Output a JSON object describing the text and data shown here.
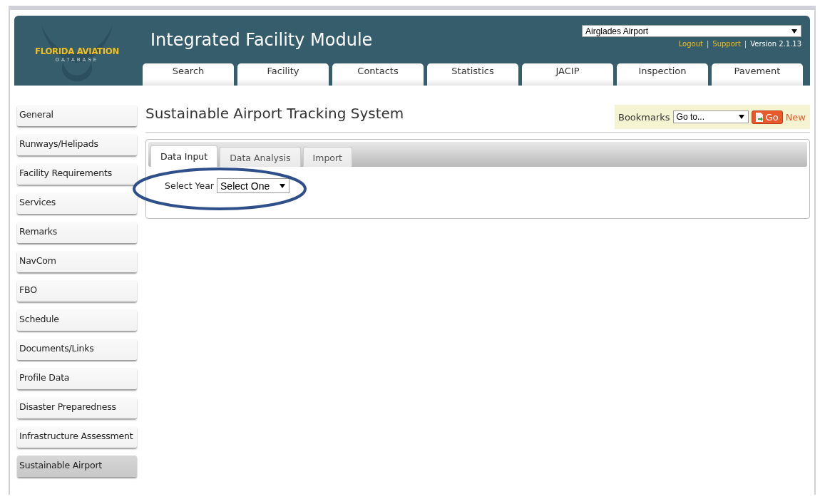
{
  "header": {
    "logo_title": "FLORIDA AVIATION",
    "logo_subtitle": "DATABASE",
    "title": "Integrated Facility Module",
    "airport_select": {
      "value": "Airglades Airport"
    },
    "links": [
      {
        "kind": "link",
        "text": "Logout"
      },
      {
        "kind": "separator",
        "text": "|"
      },
      {
        "kind": "link",
        "text": "Support"
      },
      {
        "kind": "separator",
        "text": "|"
      },
      {
        "kind": "text",
        "text": "Version 2.1.13"
      }
    ]
  },
  "nav_tabs": [
    {
      "label": "Search"
    },
    {
      "label": "Facility"
    },
    {
      "label": "Contacts"
    },
    {
      "label": "Statistics"
    },
    {
      "label": "JACIP"
    },
    {
      "label": "Inspection"
    },
    {
      "label": "Pavement"
    }
  ],
  "sidebar": {
    "items": [
      {
        "label": "General",
        "selected": false
      },
      {
        "label": "Runways/Helipads",
        "selected": false
      },
      {
        "label": "Facility Requirements",
        "selected": false
      },
      {
        "label": "Services",
        "selected": false
      },
      {
        "label": "Remarks",
        "selected": false
      },
      {
        "label": "NavCom",
        "selected": false
      },
      {
        "label": "FBO",
        "selected": false
      },
      {
        "label": "Schedule",
        "selected": false
      },
      {
        "label": "Documents/Links",
        "selected": false
      },
      {
        "label": "Profile Data",
        "selected": false
      },
      {
        "label": "Disaster Preparedness",
        "selected": false
      },
      {
        "label": "Infrastructure Assessment",
        "selected": false
      },
      {
        "label": "Sustainable Airport",
        "selected": true
      }
    ]
  },
  "page_title": "Sustainable Airport Tracking System",
  "bookmarks": {
    "label": "Bookmarks",
    "select": {
      "value": "Go to..."
    },
    "go_button": "Go",
    "new_link": "New"
  },
  "content_tabs": [
    {
      "label": "Data Input",
      "selected": true
    },
    {
      "label": "Data Analysis",
      "selected": false
    },
    {
      "label": "Import",
      "selected": false
    }
  ],
  "form": {
    "label": "Select Year",
    "select": {
      "value": "Select One"
    },
    "highlighted": true
  }
}
